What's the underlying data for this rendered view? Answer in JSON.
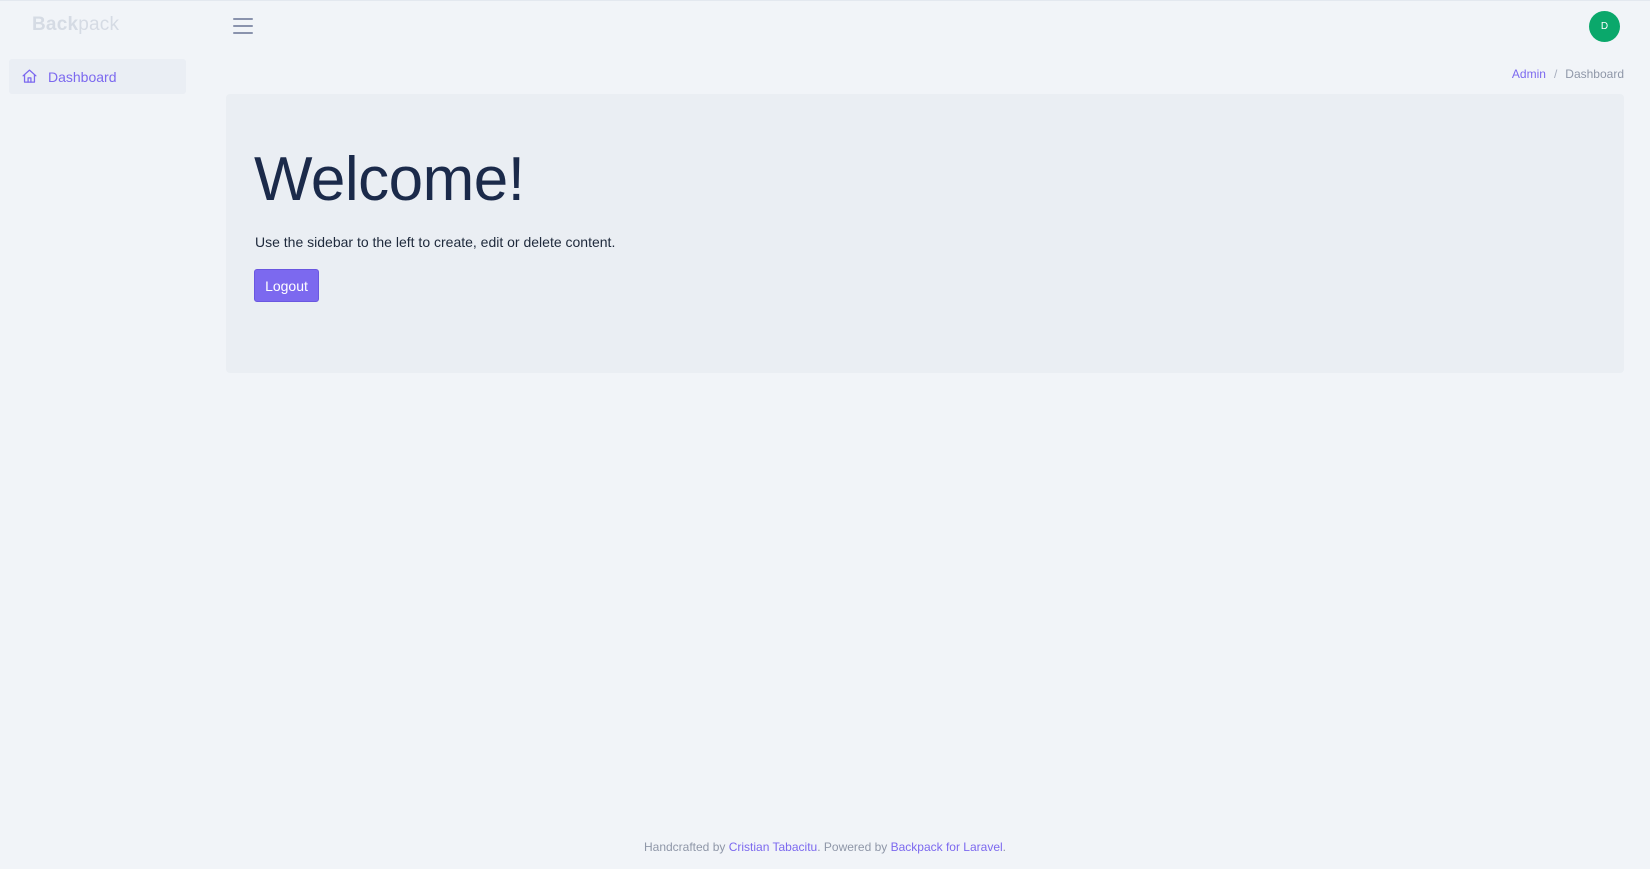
{
  "brand": {
    "bold": "Back",
    "light": "pack"
  },
  "user": {
    "initial": "D",
    "avatar_color": "#0aa86b"
  },
  "sidebar": {
    "items": [
      {
        "label": "Dashboard",
        "icon": "home-icon"
      }
    ]
  },
  "breadcrumb": {
    "parent": "Admin",
    "separator": "/",
    "current": "Dashboard"
  },
  "main": {
    "title": "Welcome!",
    "subtitle": "Use the sidebar to the left to create, edit or delete content.",
    "logout_label": "Logout"
  },
  "footer": {
    "prefix": "Handcrafted by",
    "author": "Cristian Tabacitu",
    "middle": ". Powered by",
    "product": "Backpack for Laravel",
    "suffix": "."
  },
  "colors": {
    "accent": "#7c69ef",
    "background": "#f1f4f8",
    "jumbotron": "#eaeef3"
  }
}
